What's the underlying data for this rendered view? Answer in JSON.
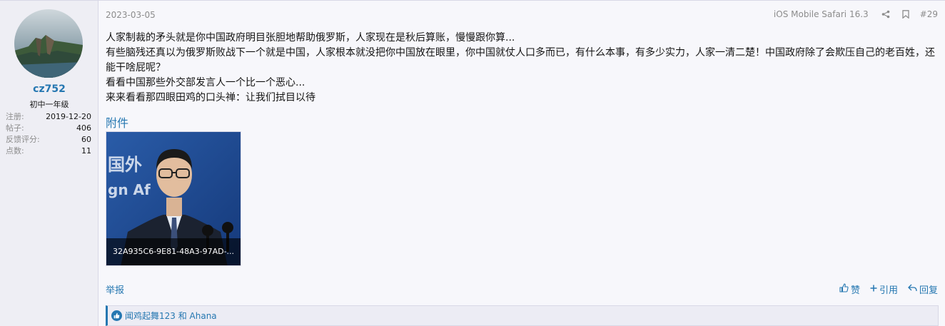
{
  "user": {
    "name": "cz752",
    "title": "初中一年级",
    "stats": [
      {
        "label": "注册:",
        "value": "2019-12-20"
      },
      {
        "label": "帖子:",
        "value": "406"
      },
      {
        "label": "反馈评分:",
        "value": "60"
      },
      {
        "label": "点数:",
        "value": "11"
      }
    ]
  },
  "post": {
    "date": "2023-03-05",
    "user_agent": "iOS Mobile Safari 16.3",
    "number": "#29",
    "lines": [
      "人家制裁的矛头就是你中国政府明目张胆地帮助俄罗斯，人家现在是秋后算账，慢慢跟你算...",
      "有些脑残还真以为俄罗斯败战下一个就是中国，人家根本就没把你中国放在眼里，你中国就仗人口多而已，有什么本事，有多少实力，人家一清二楚！中国政府除了会欺压自己的老百姓，还能干啥屁呢？",
      "看看中国那些外交部发言人一个比一个恶心...",
      "来来看看那四眼田鸡的口头禅：让我们拭目以待"
    ],
    "attachments_heading": "附件",
    "attachment": {
      "filename": "32A935C6-9E81-48A3-97AD-...",
      "backdrop_text": "国外",
      "backdrop_text2": "gn Af"
    },
    "report_label": "举报",
    "actions": {
      "like": "赞",
      "quote": "引用",
      "reply": "回复"
    },
    "reactions_text": "闻鸡起舞123 和 Ahana"
  },
  "colors": {
    "link": "#2577b1",
    "user_bg": "#eeeef4",
    "main_bg": "#f7f7fb",
    "muted": "#8c8c8c"
  }
}
